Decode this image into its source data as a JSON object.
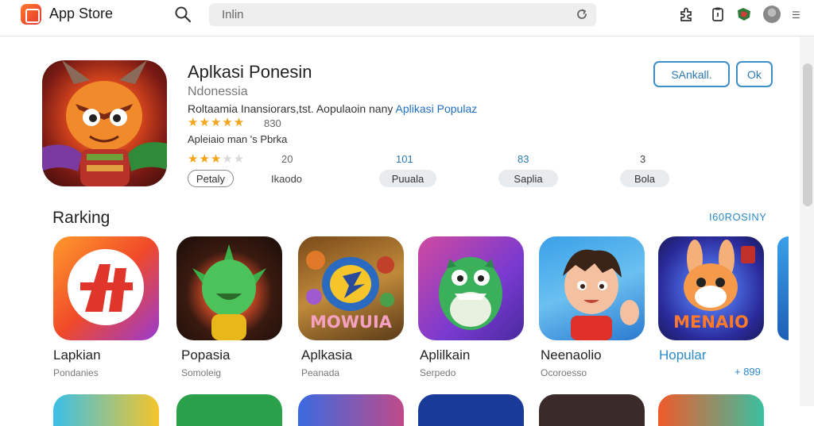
{
  "topbar": {
    "app_name": "App Store",
    "search_value": "Inlin",
    "icons": [
      "app-store-logo-icon",
      "search-icon",
      "reload-icon",
      "puzzle-icon",
      "clipboard-icon",
      "extension-icon",
      "avatar",
      "menu-icon"
    ]
  },
  "featured": {
    "title": "Aplkasi Ponesin",
    "subtitle": "Ndonessia",
    "description": "Roltaamia Inansiorars,tst. Aopulaoin nany",
    "description_highlight": "Aplikasi Populaz",
    "rating_1": {
      "stars": 4.5,
      "text": "830"
    },
    "meta": "Apleiaio man 's Pbrka",
    "rating_2": {
      "stars": 3.5,
      "text": "20"
    },
    "buttons": {
      "primary": "SAnkall.",
      "secondary": "Ok"
    },
    "stats": [
      {
        "value": "",
        "label": "Petaly",
        "style": "outline"
      },
      {
        "value": "",
        "label": "Ikaodo",
        "style": "plain"
      },
      {
        "value": "101",
        "label": "Puuala",
        "style": "filled"
      },
      {
        "value": "83",
        "label": "Saplia",
        "style": "filled"
      },
      {
        "value": "3",
        "label": "Bola",
        "style": "filled"
      }
    ]
  },
  "ranking": {
    "title": "Rarking",
    "link": "I60ROSINY",
    "apps": [
      {
        "name": "Lapkian",
        "category": "Pondanies",
        "icon": "letter-logo-icon"
      },
      {
        "name": "Popasia",
        "category": "Somoleig",
        "icon": "green-creature-icon"
      },
      {
        "name": "Aplkasia",
        "category": "Peanada",
        "icon": "mowuia-game-icon",
        "tile_text": "MOWUIA"
      },
      {
        "name": "Aplilkain",
        "category": "Serpedo",
        "icon": "green-monster-icon"
      },
      {
        "name": "Neenaolio",
        "category": "Ocoroesso",
        "icon": "boy-character-icon"
      },
      {
        "name": "Hopular",
        "category": "",
        "icon": "rabbit-game-icon",
        "tile_text": "MENAIO",
        "price": "+ 899"
      }
    ]
  },
  "colors": {
    "accent": "#2b8ac6",
    "star": "#f2a51a",
    "button_border": "#3e8fc8"
  }
}
